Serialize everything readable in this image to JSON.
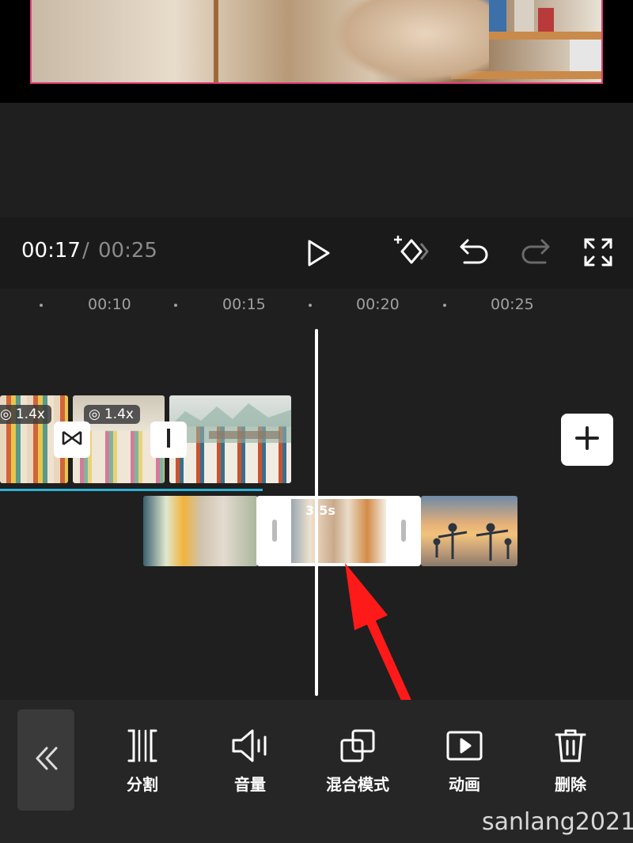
{
  "playback": {
    "current_time": "00:17",
    "separator": "/",
    "total_time": "00:25"
  },
  "ruler": {
    "labels": [
      "00:10",
      "00:15",
      "00:20",
      "00:25"
    ]
  },
  "main_track": {
    "clips": [
      {
        "speed": "1.4x"
      },
      {
        "speed": "1.4x"
      }
    ]
  },
  "overlay_track": {
    "selected_duration": "3.5s"
  },
  "toolbar": {
    "items": [
      {
        "label": "分割",
        "icon": "split-icon"
      },
      {
        "label": "音量",
        "icon": "volume-icon"
      },
      {
        "label": "混合模式",
        "icon": "blend-mode-icon"
      },
      {
        "label": "动画",
        "icon": "animation-icon"
      },
      {
        "label": "删除",
        "icon": "delete-icon"
      }
    ]
  },
  "watermark": "sanlang2021",
  "colors": {
    "selection_border": "#e0407a",
    "track_underline": "#2bb3d6",
    "annotation_arrow": "#ff1a1a"
  }
}
